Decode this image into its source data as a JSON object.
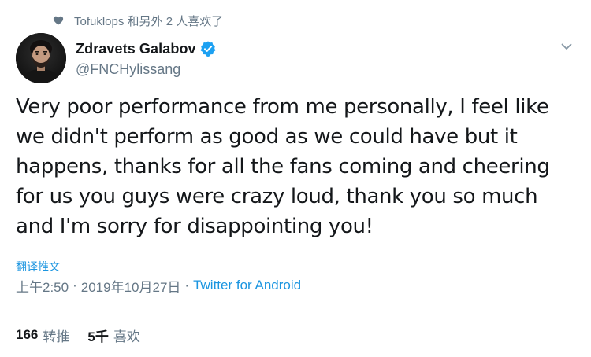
{
  "social_context": {
    "text": "Tofuklops 和另外 2 人喜欢了",
    "icon": "heart-icon"
  },
  "author": {
    "display_name": "Zdravets Galabov",
    "handle": "@FNCHylissang",
    "verified_icon": "verified-badge-icon",
    "avatar_icon": "avatar"
  },
  "menu": {
    "icon": "chevron-down-icon"
  },
  "tweet": {
    "text": "Very poor performance from me personally, I feel like we didn't perform as good as we could have but it happens, thanks for all the fans coming and cheering for us you guys were crazy loud, thank you so much and I'm sorry for disappointing you!"
  },
  "translate_label": "翻译推文",
  "meta": {
    "time": "上午2:50",
    "separator": "·",
    "date": "2019年10月27日",
    "source": "Twitter for Android"
  },
  "stats": {
    "retweets": {
      "count": "166",
      "label": "转推"
    },
    "likes": {
      "count": "5千",
      "label": "喜欢"
    }
  },
  "colors": {
    "accent": "#1b95e0",
    "verified": "#1da1f2",
    "secondary_text": "#657786",
    "primary_text": "#14171a",
    "divider": "#e6ecf0"
  }
}
